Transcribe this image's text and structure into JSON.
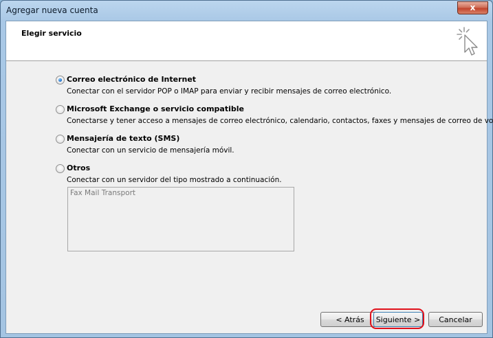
{
  "window": {
    "title": "Agregar nueva cuenta",
    "close_symbol": "x"
  },
  "header": {
    "title": "Elegir servicio",
    "icon": "pointer-sparkle-icon"
  },
  "options": [
    {
      "label": "Correo electrónico de Internet",
      "description": "Conectar con el servidor POP o IMAP para enviar y recibir mensajes de correo electrónico.",
      "checked": true
    },
    {
      "label": "Microsoft Exchange o servicio compatible",
      "description": "Conectarse y tener acceso a mensajes de correo electrónico, calendario, contactos, faxes y mensajes de correo de voz.",
      "checked": false
    },
    {
      "label": "Mensajería de texto (SMS)",
      "description": "Conectar con un servicio de mensajería móvil.",
      "checked": false
    },
    {
      "label": "Otros",
      "description": "Conectar con un servidor del tipo mostrado a continuación.",
      "checked": false
    }
  ],
  "other_services": {
    "items": [
      "Fax Mail Transport"
    ]
  },
  "buttons": {
    "back": "< Atrás",
    "next": "Siguiente >",
    "cancel": "Cancelar"
  },
  "colors": {
    "highlight": "#e0101a",
    "radio_selected": "#1c6fcc"
  }
}
